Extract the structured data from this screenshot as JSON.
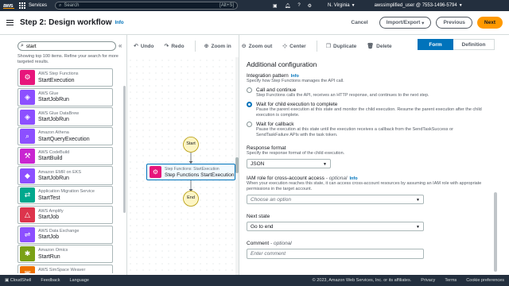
{
  "topnav": {
    "logo": "aws",
    "services": "Services",
    "search_placeholder": "Search",
    "search_shortcut": "[Alt+S]",
    "region": "N. Virginia",
    "user": "awssimplified_user @ 7553-1496-5794"
  },
  "header": {
    "title": "Step 2: Design workflow",
    "info": "Info",
    "cancel": "Cancel",
    "import_export": "Import/Export",
    "previous": "Previous",
    "next": "Next"
  },
  "left": {
    "search_value": "start",
    "hint": "Showing top 100 items. Refine your search for more targeted results.",
    "items": [
      {
        "service": "AWS Step Functions",
        "action": "StartExecution",
        "color": "#e7157b",
        "glyph": "⚙"
      },
      {
        "service": "AWS Glue",
        "action": "StartJobRun",
        "color": "#8c4fff",
        "glyph": "◈"
      },
      {
        "service": "AWS Glue DataBrew",
        "action": "StartJobRun",
        "color": "#8c4fff",
        "glyph": "◈"
      },
      {
        "service": "Amazon Athena",
        "action": "StartQueryExecution",
        "color": "#8c4fff",
        "glyph": "⌕"
      },
      {
        "service": "AWS CodeBuild",
        "action": "StartBuild",
        "color": "#c925d1",
        "glyph": "⚒"
      },
      {
        "service": "Amazon EMR on EKS",
        "action": "StartJobRun",
        "color": "#8c4fff",
        "glyph": "◆"
      },
      {
        "service": "Application Migration Service",
        "action": "StartTest",
        "color": "#01a88d",
        "glyph": "⇄"
      },
      {
        "service": "AWS Amplify",
        "action": "StartJob",
        "color": "#dd344c",
        "glyph": "△"
      },
      {
        "service": "AWS Data Exchange",
        "action": "StartJob",
        "color": "#8c4fff",
        "glyph": "⇌"
      },
      {
        "service": "Amazon Omics",
        "action": "StartRun",
        "color": "#7aa116",
        "glyph": "✱"
      },
      {
        "service": "AWS SimSpace Weaver",
        "action": "StartApp",
        "color": "#ed7100",
        "glyph": "▣"
      }
    ]
  },
  "toolbar": {
    "undo": "Undo",
    "redo": "Redo",
    "zoom_in": "Zoom in",
    "zoom_out": "Zoom out",
    "center": "Center",
    "duplicate": "Duplicate",
    "delete": "Delete"
  },
  "canvas": {
    "start": "Start",
    "end": "End",
    "node_service": "Step Functions: StartExecution",
    "node_name": "Step Functions StartExecution"
  },
  "right": {
    "tab_form": "Form",
    "tab_definition": "Definition",
    "section_title": "Additional configuration",
    "integration_label": "Integration pattern",
    "integration_info": "Info",
    "integration_desc": "Specify how Step Functions manages the API call.",
    "radio1_label": "Call and continue",
    "radio1_desc": "Step Functions calls the API, receives an HTTP response, and continues to the next step.",
    "radio2_label": "Wait for child execution to complete",
    "radio2_desc": "Pause the parent execution at this state and monitor the child execution. Resume the parent execution after the child execution is complete.",
    "radio3_label": "Wait for callback",
    "radio3_desc": "Pause the execution at this state until the execution receives a callback from the SendTaskSuccess or SendTaskFailure APIs with the task token.",
    "response_label": "Response format",
    "response_desc": "Specify the response format of the child execution.",
    "response_value": "JSON",
    "iam_label": "IAM role for cross-account access",
    "iam_optional": "- optional",
    "iam_info": "Info",
    "iam_desc": "When your execution reaches this state, it can access cross-account resources by assuming an IAM role with appropriate permissions in the target account.",
    "iam_placeholder": "Choose an option",
    "next_label": "Next state",
    "next_value": "Go to end",
    "comment_label": "Comment",
    "comment_optional": "- optional",
    "comment_placeholder": "Enter comment"
  },
  "footer": {
    "cloudshell": "CloudShell",
    "feedback": "Feedback",
    "language": "Language",
    "copyright": "© 2023, Amazon Web Services, Inc. or its affiliates.",
    "privacy": "Privacy",
    "terms": "Terms",
    "cookies": "Cookie preferences"
  }
}
